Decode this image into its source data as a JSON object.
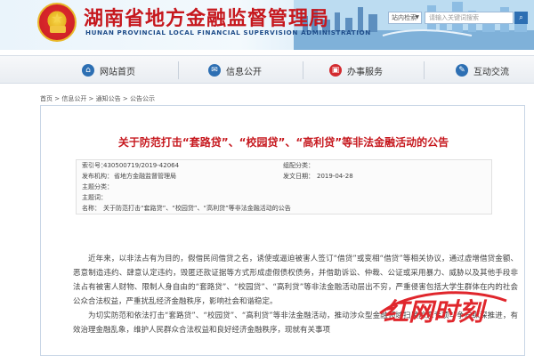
{
  "header": {
    "title": "湖南省地方金融监督管理局",
    "subtitle": "HUNAN PROVINCIAL LOCAL FINANCIAL SUPERVISION ADMINISTRATION",
    "search_scope": "站内检索",
    "search_placeholder": "请输入关键词搜索",
    "search_icon": "magnifier-icon"
  },
  "nav": {
    "items": [
      {
        "label": "网站首页",
        "icon": "home-icon"
      },
      {
        "label": "信息公开",
        "icon": "chat-icon"
      },
      {
        "label": "办事服务",
        "icon": "briefcase-icon"
      },
      {
        "label": "互动交流",
        "icon": "speech-icon"
      }
    ]
  },
  "breadcrumb": "首页 > 信息公开 > 通知公告 > 公告公示",
  "article": {
    "title": "关于防范打击“套路贷”、“校园贷”、“高利贷”等非法金融活动的公告",
    "meta": {
      "index_label": "索引号：",
      "index_value": "430500719/2019-42064",
      "category_label": "组配分类：",
      "category_value": "",
      "org_label": "发布机构：",
      "org_value": "省地方金融监督管理局",
      "date_label": "发文日期：",
      "date_value": "2019-04-28",
      "subject_cat_label": "主题分类：",
      "subject_cat_value": "",
      "subject_word_label": "主题词：",
      "subject_word_value": "",
      "name_label": "名称：",
      "name_value": "关于防范打击“套路贷”、“校园贷”、“高利贷”等非法金融活动的公告"
    },
    "paragraphs": [
      "近年来，以非法占有为目的，假借民间借贷之名，诱使或逼迫被害人签订“借贷”或变相“借贷”等相关协议，通过虚增借贷金额、恶意制造违约、肆意认定违约，毁匿还款证据等方式形成虚假债权债务，并借助诉讼、仲裁、公证或采用暴力、威胁以及其他手段非法占有被害人财物、限制人身自由的“套路贷”、“校园贷”、“高利贷”等非法金融活动层出不穷，严重侵害包括大学生群体在内的社会公众合法权益，严重扰乱经济金融秩序，影响社会和谐稳定。",
      "为切实防范和依法打击“套路贷”、“校园贷”、“高利贷”等非法金融活动，推动涉众型金融领域扫黑除恶专项斗争向纵深推进，有效治理金融乱象，维护人民群众合法权益和良好经济金融秩序，现就有关事项"
    ]
  },
  "watermark": {
    "text": "红网时刻",
    "color": "#e0262c"
  }
}
